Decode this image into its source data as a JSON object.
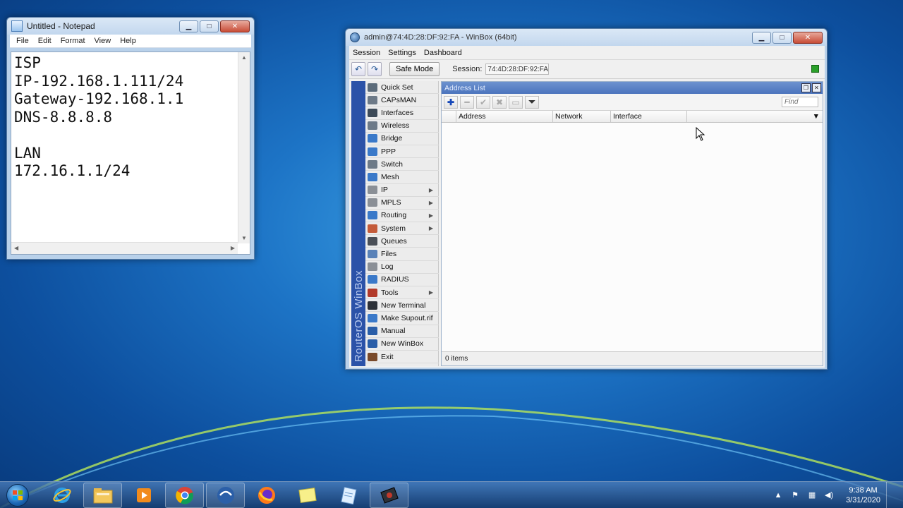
{
  "notepad": {
    "title": "Untitled - Notepad",
    "menu": [
      "File",
      "Edit",
      "Format",
      "View",
      "Help"
    ],
    "content": "ISP\nIP-192.168.1.111/24\nGateway-192.168.1.1\nDNS-8.8.8.8\n\nLAN\n172.16.1.1/24"
  },
  "winbox": {
    "title": "admin@74:4D:28:DF:92:FA - WinBox (64bit)",
    "menu": [
      "Session",
      "Settings",
      "Dashboard"
    ],
    "safe_mode_label": "Safe Mode",
    "session_label": "Session:",
    "session_value": "74:4D:28:DF:92:FA",
    "vertical_brand": "RouterOS WinBox",
    "sidebar": [
      {
        "label": "Quick Set",
        "icon": "quickset-icon",
        "color": "#5b6b7a",
        "sub": false
      },
      {
        "label": "CAPsMAN",
        "icon": "capsman-icon",
        "color": "#6d7a88",
        "sub": false
      },
      {
        "label": "Interfaces",
        "icon": "interfaces-icon",
        "color": "#3d4a58",
        "sub": false
      },
      {
        "label": "Wireless",
        "icon": "wireless-icon",
        "color": "#6d7a88",
        "sub": false
      },
      {
        "label": "Bridge",
        "icon": "bridge-icon",
        "color": "#3a79c9",
        "sub": false
      },
      {
        "label": "PPP",
        "icon": "ppp-icon",
        "color": "#3a79c9",
        "sub": false
      },
      {
        "label": "Switch",
        "icon": "switch-icon",
        "color": "#6d7a88",
        "sub": false
      },
      {
        "label": "Mesh",
        "icon": "mesh-icon",
        "color": "#3a79c9",
        "sub": false
      },
      {
        "label": "IP",
        "icon": "ip-icon",
        "color": "#8a8f96",
        "sub": true
      },
      {
        "label": "MPLS",
        "icon": "mpls-icon",
        "color": "#8a8f96",
        "sub": true
      },
      {
        "label": "Routing",
        "icon": "routing-icon",
        "color": "#3a79c9",
        "sub": true
      },
      {
        "label": "System",
        "icon": "system-icon",
        "color": "#c45b3a",
        "sub": true
      },
      {
        "label": "Queues",
        "icon": "queues-icon",
        "color": "#4a4f57",
        "sub": false
      },
      {
        "label": "Files",
        "icon": "files-icon",
        "color": "#5a82b8",
        "sub": false
      },
      {
        "label": "Log",
        "icon": "log-icon",
        "color": "#8a8f96",
        "sub": false
      },
      {
        "label": "RADIUS",
        "icon": "radius-icon",
        "color": "#3a79c9",
        "sub": false
      },
      {
        "label": "Tools",
        "icon": "tools-icon",
        "color": "#b23a2a",
        "sub": true
      },
      {
        "label": "New Terminal",
        "icon": "terminal-icon",
        "color": "#2d3138",
        "sub": false
      },
      {
        "label": "Make Supout.rif",
        "icon": "supout-icon",
        "color": "#3a79c9",
        "sub": false
      },
      {
        "label": "Manual",
        "icon": "manual-icon",
        "color": "#2a5ea8",
        "sub": false
      },
      {
        "label": "New WinBox",
        "icon": "winbox-icon",
        "color": "#2a5ea8",
        "sub": false
      },
      {
        "label": "Exit",
        "icon": "exit-icon",
        "color": "#7a4a2a",
        "sub": false
      }
    ],
    "address_list": {
      "title": "Address List",
      "find_placeholder": "Find",
      "columns": [
        "Address",
        "Network",
        "Interface"
      ],
      "status": "0 items"
    }
  },
  "taskbar": {
    "apps": [
      "start-button",
      "internet-explorer",
      "file-explorer",
      "media-player",
      "chrome",
      "winbox-app",
      "firefox",
      "sticky-notes",
      "notepad-app",
      "winbox-taskbar"
    ],
    "time": "9:38 AM",
    "date": "3/31/2020"
  }
}
